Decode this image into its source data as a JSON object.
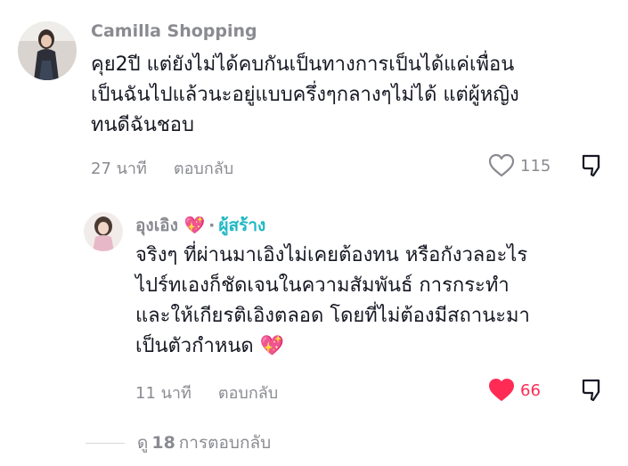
{
  "comments": [
    {
      "username": "Camilla Shopping",
      "text_lines": [
        "คุย2ปี แต่ยังไม่ได้คบกันเป็นทางการเป็นได้แค่เพื่อน",
        "เป็นฉันไปแล้วนะอยู่แบบครึ่งๆกลางๆไม่ได้ แต่ผู้หญิง",
        "ทนดีฉันชอบ"
      ],
      "time": "27 นาที",
      "reply_label": "ตอบกลับ",
      "likes": "115",
      "liked": false
    },
    {
      "username": "อุงเอิง",
      "username_emoji": "💖",
      "creator_label": "ผู้สร้าง",
      "text_lines": [
        "จริงๆ ที่ผ่านมาเอิงไม่เคยต้องทน หรือกังวลอะไร",
        "ไปร์ทเองก็ชัดเจนในความสัมพันธ์ การกระทำ",
        "และให้เกียรติเอิงตลอด โดยที่ไม่ต้องมีสถานะมา",
        "เป็นตัวกำหนด"
      ],
      "text_emoji": "💖",
      "time": "11 นาที",
      "reply_label": "ตอบกลับ",
      "likes": "66",
      "liked": true
    }
  ],
  "view_replies": {
    "prefix": "ดู",
    "count": "18",
    "suffix": "การตอบกลับ"
  },
  "colors": {
    "like_active": "#fe2c55",
    "muted": "#8a8b91",
    "creator": "#20b8c4"
  }
}
